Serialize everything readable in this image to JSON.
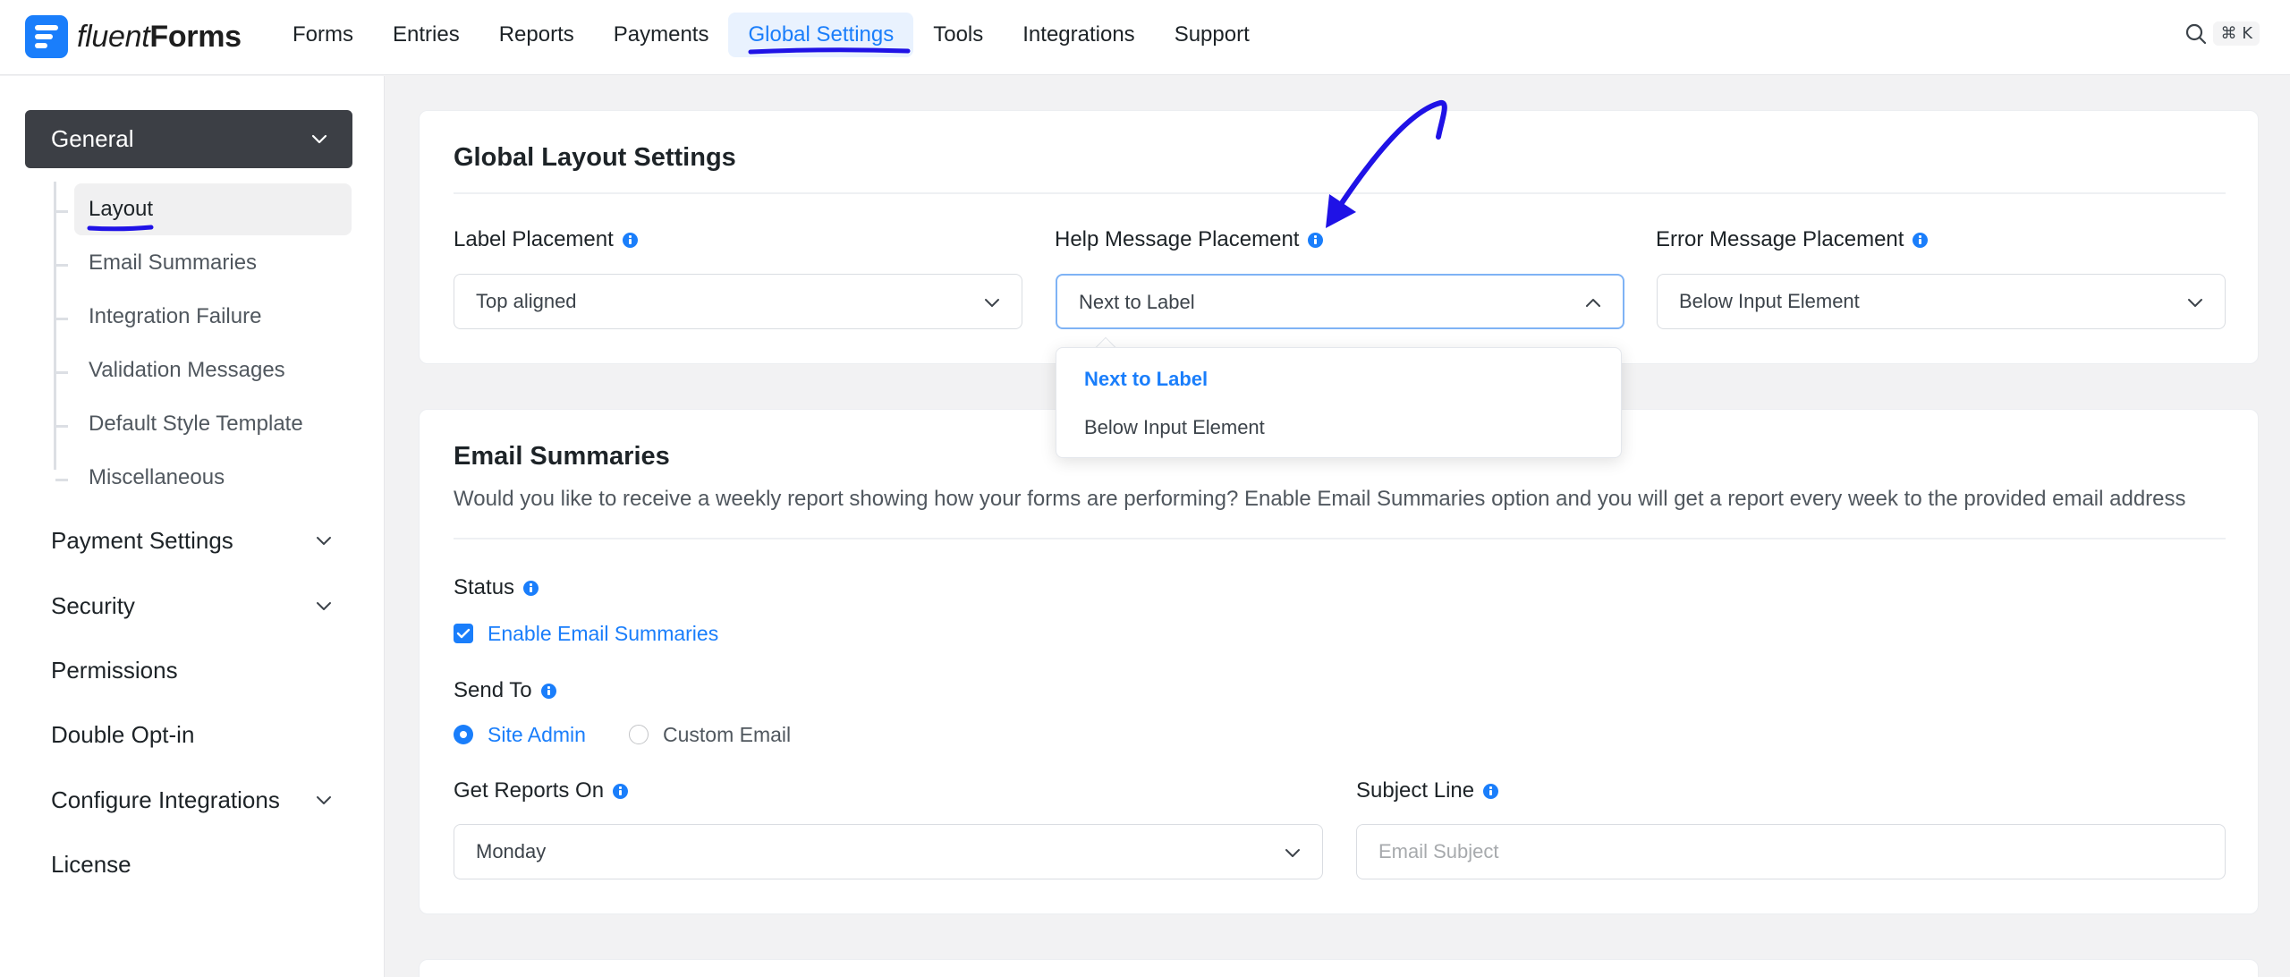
{
  "header": {
    "logo_light": "fluent",
    "logo_bold": "Forms",
    "nav": [
      "Forms",
      "Entries",
      "Reports",
      "Payments",
      "Global Settings",
      "Tools",
      "Integrations",
      "Support"
    ],
    "active_nav": "Global Settings",
    "search_shortcut": "⌘ K"
  },
  "sidebar": {
    "general_label": "General",
    "sub_items": [
      "Layout",
      "Email Summaries",
      "Integration Failure",
      "Validation Messages",
      "Default Style Template",
      "Miscellaneous"
    ],
    "active_sub_item": "Layout",
    "items": [
      {
        "label": "Payment Settings",
        "has_children": true
      },
      {
        "label": "Security",
        "has_children": true
      },
      {
        "label": "Permissions",
        "has_children": false
      },
      {
        "label": "Double Opt-in",
        "has_children": false
      },
      {
        "label": "Configure Integrations",
        "has_children": true
      },
      {
        "label": "License",
        "has_children": false
      }
    ]
  },
  "layout_card": {
    "title": "Global Layout Settings",
    "label_placement": {
      "label": "Label Placement",
      "value": "Top aligned"
    },
    "help_placement": {
      "label": "Help Message Placement",
      "value": "Next to Label",
      "options": [
        "Next to Label",
        "Below Input Element"
      ]
    },
    "error_placement": {
      "label": "Error Message Placement",
      "value": "Below Input Element"
    }
  },
  "email_card": {
    "title": "Email Summaries",
    "description": "Would you like to receive a weekly report showing how your forms are performing? Enable Email Summaries option and you will get a report every week to the provided email address",
    "status_label": "Status",
    "enable_label": "Enable Email Summaries",
    "enabled": true,
    "send_to_label": "Send To",
    "send_to_options": [
      "Site Admin",
      "Custom Email"
    ],
    "send_to_selected": "Site Admin",
    "reports_on_label": "Get Reports On",
    "reports_on_value": "Monday",
    "subject_label": "Subject Line",
    "subject_placeholder": "Email Subject"
  },
  "colors": {
    "accent": "#1a7efb",
    "annotation": "#1f12e6",
    "sidebar_active": "#3c3f45"
  }
}
